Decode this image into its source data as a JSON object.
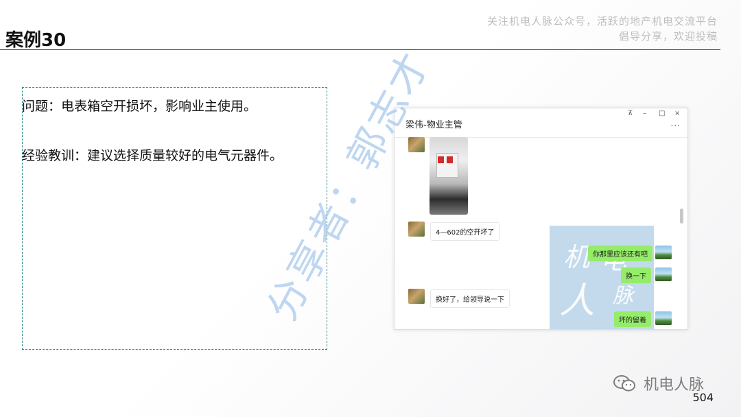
{
  "slide": {
    "title": "案例30",
    "tagline_line1": "关注机电人脉公众号，活跃的地产机电交流平台",
    "tagline_line2": "倡导分享，欢迎投稿",
    "problem": "问题：电表箱空开损坏，影响业主使用。",
    "lesson": "经验教训：建议选择质量较好的电气元器件。",
    "watermark": "分享者：郭志才",
    "page_number": "504",
    "brand": "机电人脉"
  },
  "chat": {
    "contact_name": "梁伟-物业主管",
    "window_controls": [
      "⊼",
      "–",
      "□",
      "×"
    ],
    "more_label": "···",
    "messages": [
      {
        "side": "left",
        "kind": "image",
        "alt": "电表箱照片"
      },
      {
        "side": "left",
        "kind": "text",
        "text": "4—602的空开坏了"
      },
      {
        "side": "right",
        "kind": "text",
        "text": "你那里应该还有吧"
      },
      {
        "side": "right",
        "kind": "text",
        "text": "换一下"
      },
      {
        "side": "left",
        "kind": "text",
        "text": "换好了，给领导说一下"
      },
      {
        "side": "right",
        "kind": "text",
        "text": "坏的留着"
      }
    ],
    "overlay_logo": {
      "chars": [
        "机",
        "电",
        "人",
        "脉"
      ]
    }
  },
  "colors": {
    "accent_line": "#1f4e5a",
    "box_border": "#3a8f8a",
    "watermark": "#a9c9ec",
    "bubble_right": "#95ec69"
  }
}
